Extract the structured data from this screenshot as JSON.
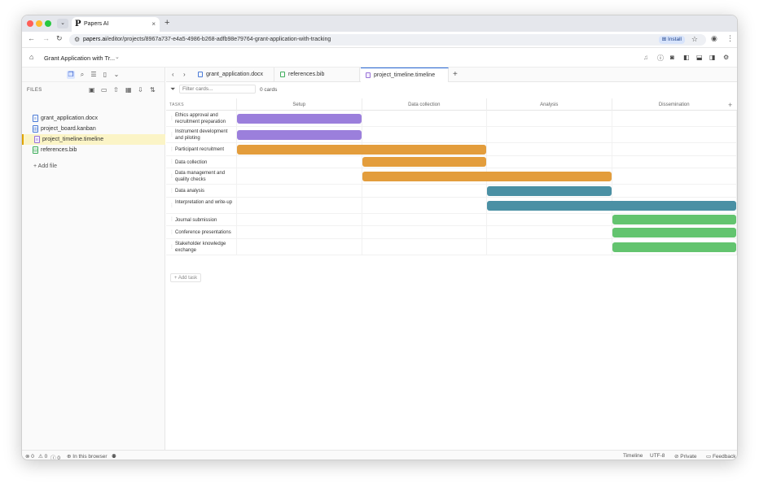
{
  "browser": {
    "tab_title": "Papers AI",
    "tab_logo": "P",
    "url_host": "papers.ai",
    "url_path": "/editor/projects/8967a737-e4a5-4986-b268-adfb98e79764-grant-application-with-tracking",
    "install_label": "Install",
    "new_tab": "+"
  },
  "app": {
    "project_title": "Grant Application with Tr..."
  },
  "sidebar": {
    "files_header": "FILES",
    "files": [
      {
        "name": "grant_application.docx",
        "icon": "doc-icon",
        "glyph": "≡"
      },
      {
        "name": "project_board.kanban",
        "icon": "kanban-icon",
        "glyph": "▥"
      },
      {
        "name": "project_timeline.timeline",
        "icon": "timeline-icon",
        "glyph": "≡"
      },
      {
        "name": "references.bib",
        "icon": "bib-icon",
        "glyph": "▤"
      }
    ],
    "add_file": "+ Add file"
  },
  "editor": {
    "tabs": [
      {
        "label": "grant_application.docx",
        "icon": "doc-icon"
      },
      {
        "label": "references.bib",
        "icon": "bib-icon"
      },
      {
        "label": "project_timeline.timeline",
        "icon": "timeline-icon"
      }
    ],
    "add_tab": "+"
  },
  "timeline": {
    "filter_placeholder": "Filter cards...",
    "card_count": "0 cards",
    "tasks_header": "TASKS",
    "phases": [
      "Setup",
      "Data collection",
      "Analysis",
      "Dissemination"
    ],
    "tasks": [
      {
        "name": "Ethics approval and recruitment preparation",
        "start": 0.0,
        "end": 1.0,
        "color": "#9b7fdc"
      },
      {
        "name": "Instrument development and piloting",
        "start": 0.0,
        "end": 1.0,
        "color": "#9b7fdc"
      },
      {
        "name": "Participant recruitment",
        "start": 0.0,
        "end": 2.0,
        "color": "#e39d3c"
      },
      {
        "name": "Data collection",
        "start": 1.0,
        "end": 2.0,
        "color": "#e39d3c"
      },
      {
        "name": "Data management and quality checks",
        "start": 1.0,
        "end": 3.0,
        "color": "#e39d3c"
      },
      {
        "name": "Data analysis",
        "start": 2.0,
        "end": 3.0,
        "color": "#4a90a4"
      },
      {
        "name": "Interpretation and write-up",
        "start": 2.0,
        "end": 4.0,
        "color": "#4a90a4"
      },
      {
        "name": "Journal submission",
        "start": 3.0,
        "end": 4.0,
        "color": "#63c46f"
      },
      {
        "name": "Conference presentations",
        "start": 3.0,
        "end": 4.0,
        "color": "#63c46f"
      },
      {
        "name": "Stakeholder knowledge exchange",
        "start": 3.0,
        "end": 4.0,
        "color": "#63c46f"
      }
    ],
    "add_task": "+ Add task"
  },
  "status": {
    "errors": "0",
    "warnings": "0",
    "info": "0",
    "browser": "In this browser",
    "view": "Timeline",
    "encoding": "UTF-8",
    "privacy": "Private",
    "feedback": "Feedback"
  }
}
